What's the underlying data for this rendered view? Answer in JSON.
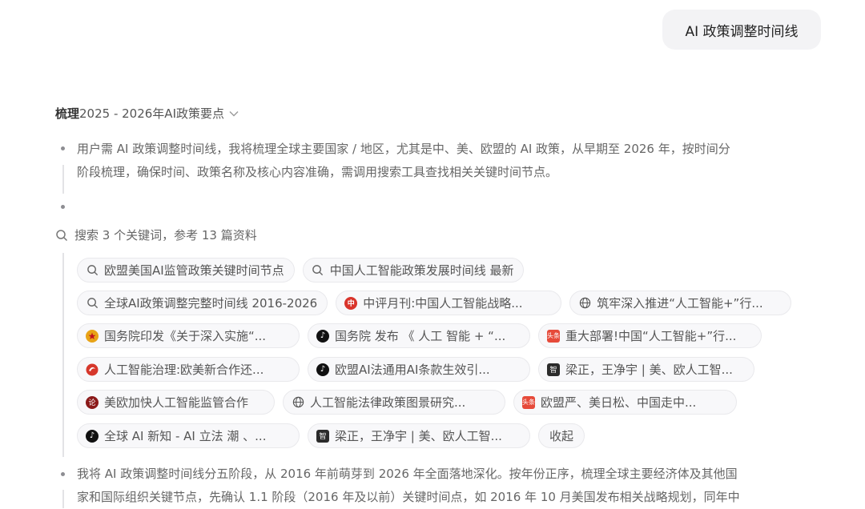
{
  "user_message": "AI 政策调整时间线",
  "thinking": {
    "title_bold": "梳理",
    "title_rest": "2025 - 2026年AI政策要点",
    "step1_line1": "用户需 AI 政策调整时间线，我将梳理全球主要国家 / 地区，尤其是中、美、欧盟的 AI 政策，从早期至 2026 年，按时间分",
    "step1_line2": "阶段梳理，确保时间、政策名称及核心内容准确，需调用搜索工具查找相关关键时间节点。"
  },
  "search": {
    "summary": "搜索 3 个关键词，参考 13 篇资料",
    "rows": [
      [
        {
          "icon": "search-icon",
          "label": "欧盟美国AI监管政策关键时间节点"
        },
        {
          "icon": "search-icon",
          "label": "中国人工智能政策发展时间线 最新"
        }
      ],
      [
        {
          "icon": "search-icon",
          "label": "全球AI政策调整完整时间线 2016-2026"
        },
        {
          "icon": "red-seal-icon",
          "label": "中评月刊:中国人工智能战略..."
        },
        {
          "icon": "globe-icon",
          "label": "筑牢深入推进“人工智能+”行..."
        }
      ],
      [
        {
          "icon": "gov-emblem-icon",
          "label": "国务院印发《关于深入实施“..."
        },
        {
          "icon": "tiktok-icon",
          "label": "国务院 发布 《 人工 智能 + “..."
        },
        {
          "icon": "news-badge-icon",
          "label": "重大部署!中国“人工智能+”行..."
        }
      ],
      [
        {
          "icon": "red-swirl-icon",
          "label": "人工智能治理:欧美新合作还..."
        },
        {
          "icon": "tiktok-icon",
          "label": "欧盟AI法通用AI条款生效引..."
        },
        {
          "icon": "dark-square-icon",
          "label": "梁正，王净宇 | 美、欧人工智..."
        }
      ],
      [
        {
          "icon": "maroon-seal-icon",
          "label": "美欧加快人工智能监管合作"
        },
        {
          "icon": "globe-icon",
          "label": "人工智能法律政策图景研究..."
        },
        {
          "icon": "news-badge-icon",
          "label": "欧盟严、美日松、中国走中..."
        }
      ],
      [
        {
          "icon": "tiktok-icon",
          "label": "全球 AI 新知 - AI 立法 潮 、..."
        },
        {
          "icon": "dark-square-icon",
          "label": "梁正，王净宇 | 美、欧人工智..."
        },
        {
          "icon": "none",
          "label": "收起"
        }
      ]
    ]
  },
  "answer": {
    "line1": "我将 AI 政策调整时间线分五阶段，从 2016 年前萌芽到 2026 年全面落地深化。按年份正序，梳理全球主要经济体及其他国",
    "line2": "家和国际组织关键节点，先确认 1.1 阶段（2016 年及以前）关键时间点，如 2016 年 10 月美国发布相关战略规划，同年中"
  },
  "colors": {
    "chip_bg": "#f8f8fa",
    "chip_border": "#e9e9ec",
    "bubble_bg": "#f3f3f5"
  }
}
